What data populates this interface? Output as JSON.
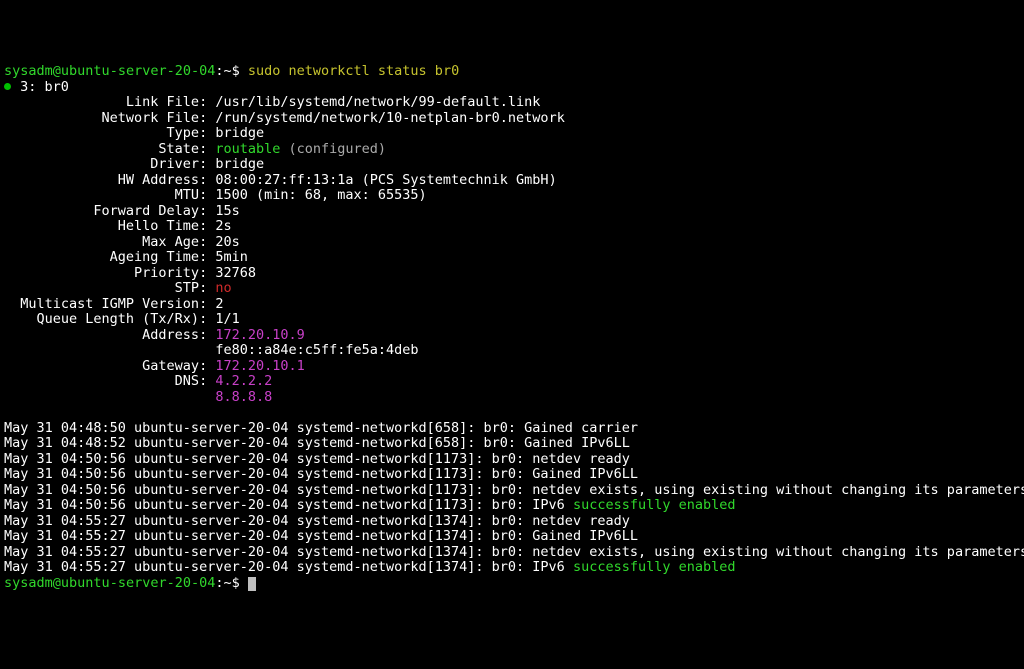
{
  "prompt": {
    "user": "sysadm",
    "sep": "@",
    "host": "ubuntu-server-20-04",
    "dir": ":~$ ",
    "cmd": "sudo networkctl status br0"
  },
  "header": {
    "idx": " 3: ",
    "name": "br0"
  },
  "fields": [
    {
      "label": "Link File",
      "value": "/usr/lib/systemd/network/99-default.link"
    },
    {
      "label": "Network File",
      "value": "/run/systemd/network/10-netplan-br0.network"
    },
    {
      "label": "Type",
      "value": "bridge"
    },
    {
      "label": "State",
      "state_green": "routable",
      "state_grey": " (configured)"
    },
    {
      "label": "Driver",
      "value": "bridge"
    },
    {
      "label": "HW Address",
      "value": "08:00:27:ff:13:1a (PCS Systemtechnik GmbH)"
    },
    {
      "label": "MTU",
      "value": "1500 (min: 68, max: 65535)"
    },
    {
      "label": "Forward Delay",
      "value": "15s"
    },
    {
      "label": "Hello Time",
      "value": "2s"
    },
    {
      "label": "Max Age",
      "value": "20s"
    },
    {
      "label": "Ageing Time",
      "value": "5min"
    },
    {
      "label": "Priority",
      "value": "32768"
    },
    {
      "label": "STP",
      "red": "no"
    },
    {
      "label": "Multicast IGMP Version",
      "value": "2"
    },
    {
      "label": "Queue Length (Tx/Rx)",
      "value": "1/1"
    },
    {
      "label": "Address",
      "magenta": "172.20.10.9"
    },
    {
      "cont": true,
      "value": "fe80::a84e:c5ff:fe5a:4deb"
    },
    {
      "label": "Gateway",
      "magenta": "172.20.10.1"
    },
    {
      "label": "DNS",
      "magenta": "4.2.2.2"
    },
    {
      "cont": true,
      "magenta": "8.8.8.8"
    }
  ],
  "log": [
    {
      "pre": "May 31 04:48:50 ubuntu-server-20-04 systemd-networkd[658]: br0: Gained carrier"
    },
    {
      "pre": "May 31 04:48:52 ubuntu-server-20-04 systemd-networkd[658]: br0: Gained IPv6LL"
    },
    {
      "pre": "May 31 04:50:56 ubuntu-server-20-04 systemd-networkd[1173]: br0: netdev ready"
    },
    {
      "pre": "May 31 04:50:56 ubuntu-server-20-04 systemd-networkd[1173]: br0: Gained IPv6LL"
    },
    {
      "pre": "May 31 04:50:56 ubuntu-server-20-04 systemd-networkd[1173]: br0: netdev exists, using existing without changing its parameters"
    },
    {
      "pre": "May 31 04:50:56 ubuntu-server-20-04 systemd-networkd[1173]: br0: IPv6 ",
      "green": "successfully enabled"
    },
    {
      "pre": "May 31 04:55:27 ubuntu-server-20-04 systemd-networkd[1374]: br0: netdev ready"
    },
    {
      "pre": "May 31 04:55:27 ubuntu-server-20-04 systemd-networkd[1374]: br0: Gained IPv6LL"
    },
    {
      "pre": "May 31 04:55:27 ubuntu-server-20-04 systemd-networkd[1374]: br0: netdev exists, using existing without changing its parameters"
    },
    {
      "pre": "May 31 04:55:27 ubuntu-server-20-04 systemd-networkd[1374]: br0: IPv6 ",
      "green": "successfully enabled"
    }
  ],
  "prompt2": {
    "user": "sysadm",
    "sep": "@",
    "host": "ubuntu-server-20-04",
    "dir": ":~$ "
  },
  "field_col": 24
}
